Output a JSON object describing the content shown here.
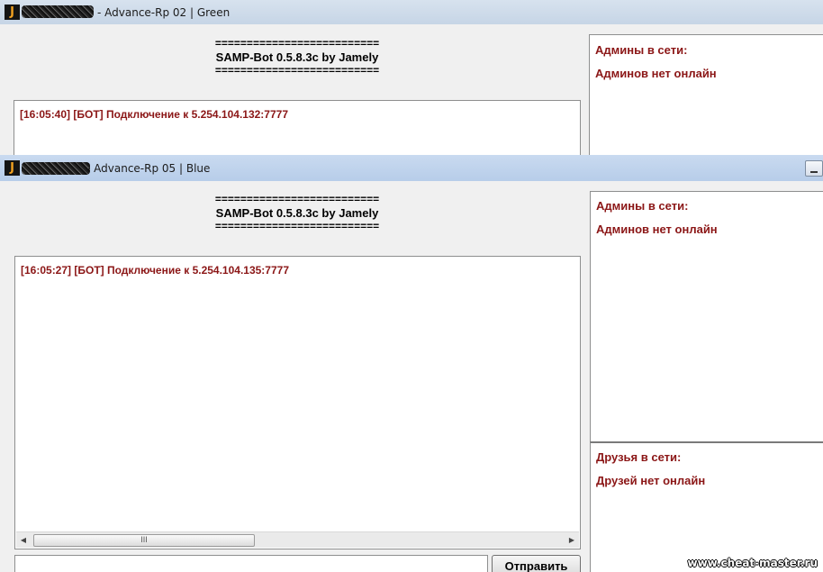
{
  "window1": {
    "app_icon": "J",
    "title": "- Advance-Rp 02 | Green",
    "header": {
      "separator": "==========================",
      "bot_name": "SAMP-Bot 0.5.8.3c by Jamely"
    },
    "chat_line": "[16:05:40] [БОТ] Подключение к 5.254.104.132:7777",
    "admins_title": "Админы в сети:",
    "admins_status": "Админов нет онлайн"
  },
  "window2": {
    "app_icon": "J",
    "title": "- Advance-Rp 05 | Blue",
    "header": {
      "separator": "==========================",
      "bot_name": "SAMP-Bot 0.5.8.3c by Jamely"
    },
    "chat_line": "[16:05:27] [БОТ] Подключение к 5.254.104.135:7777",
    "scroll_thumb": "III",
    "admins_title": "Админы в сети:",
    "admins_status": "Админов нет онлайн",
    "friends_title": "Друзья в сети:",
    "friends_status": "Друзей нет онлайн",
    "input_value": "",
    "send_label": "Отправить"
  },
  "watermark": "www.cheat-master.ru",
  "icons": {
    "app": "j-app-icon",
    "scroll_left": "chevron-left-icon",
    "scroll_right": "chevron-right-icon",
    "minimize": "minimize-icon"
  },
  "colors": {
    "accent_text": "#8b1616",
    "window_bg": "#f0f0f0"
  }
}
